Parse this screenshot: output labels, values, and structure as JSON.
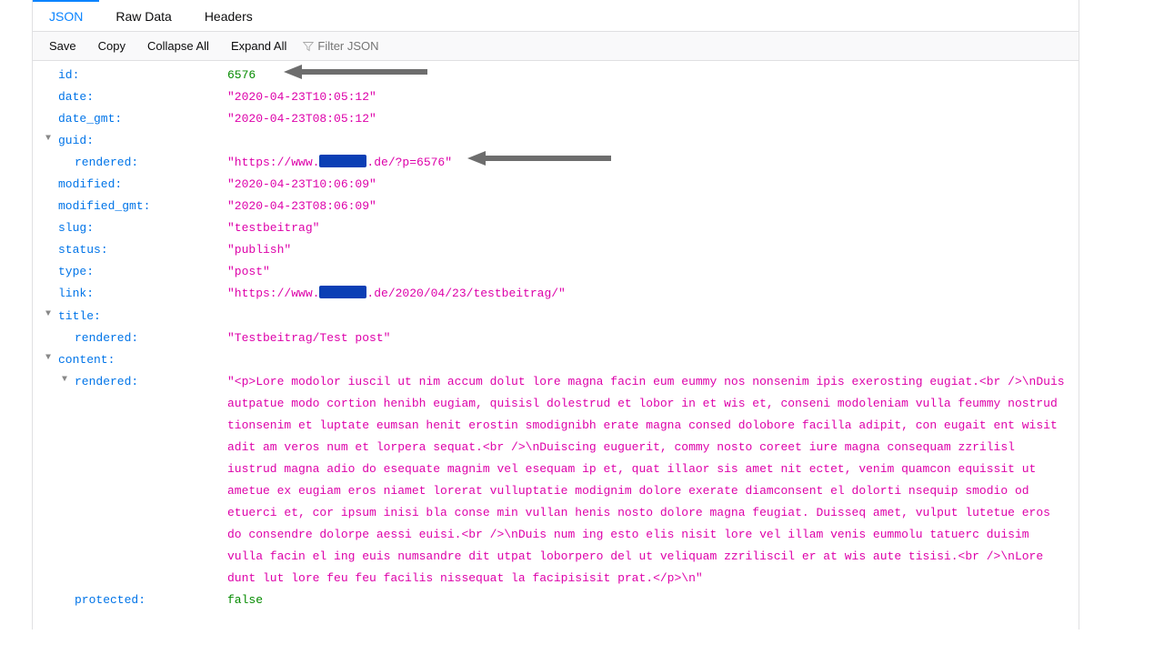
{
  "tabs": {
    "json": "JSON",
    "raw": "Raw Data",
    "headers": "Headers"
  },
  "toolbar": {
    "save": "Save",
    "copy": "Copy",
    "collapse": "Collapse All",
    "expand": "Expand All",
    "filter_placeholder": "Filter JSON"
  },
  "data": {
    "id_key": "id",
    "id_val": "6576",
    "date_key": "date",
    "date_val": "\"2020-04-23T10:05:12\"",
    "date_gmt_key": "date_gmt",
    "date_gmt_val": "\"2020-04-23T08:05:12\"",
    "guid_key": "guid",
    "guid_rendered_key": "rendered",
    "guid_rendered_pre": "\"https://www.",
    "guid_rendered_post": ".de/?p=6576\"",
    "modified_key": "modified",
    "modified_val": "\"2020-04-23T10:06:09\"",
    "modified_gmt_key": "modified_gmt",
    "modified_gmt_val": "\"2020-04-23T08:06:09\"",
    "slug_key": "slug",
    "slug_val": "\"testbeitrag\"",
    "status_key": "status",
    "status_val": "\"publish\"",
    "type_key": "type",
    "type_val": "\"post\"",
    "link_key": "link",
    "link_pre": "\"https://www.",
    "link_post": ".de/2020/04/23/testbeitrag/\"",
    "title_key": "title",
    "title_rendered_key": "rendered",
    "title_rendered_val": "\"Testbeitrag/Test post\"",
    "content_key": "content",
    "content_rendered_key": "rendered",
    "content_rendered_val": "\"<p>Lore modolor iuscil ut nim accum dolut lore magna facin eum eummy nos nonsenim ipis exerosting eugiat.<br />\\nDuis autpatue modo cortion henibh eugiam, quisisl dolestrud et lobor in et wis et, conseni modoleniam vulla feummy nostrud tionsenim et luptate eumsan henit erostin smodignibh erate magna consed dolobore facilla adipit, con eugait ent wisit adit am veros num et lorpera sequat.<br />\\nDuiscing euguerit, commy nosto coreet iure magna consequam zzrilisl iustrud magna adio do esequate magnim vel esequam ip et, quat illaor sis amet nit ectet, venim quamcon equissit ut ametue ex eugiam eros niamet lorerat vulluptatie modignim dolore exerate diamconsent el dolorti nsequip smodio od etuerci et, cor ipsum inisi bla conse min vullan henis nosto dolore magna feugiat. Duisseq amet, vulput lutetue eros do consendre dolorpe aessi euisi.<br />\\nDuis num ing esto elis nisit lore vel illam venis eummolu tatuerc duisim vulla facin el ing euis numsandre dit utpat loborpero del ut veliquam zzriliscil er at wis aute tisisi.<br />\\nLore dunt lut lore feu feu facilis nissequat la facipisisit prat.</p>\\n\"",
    "protected_key": "protected",
    "protected_val": "false"
  }
}
